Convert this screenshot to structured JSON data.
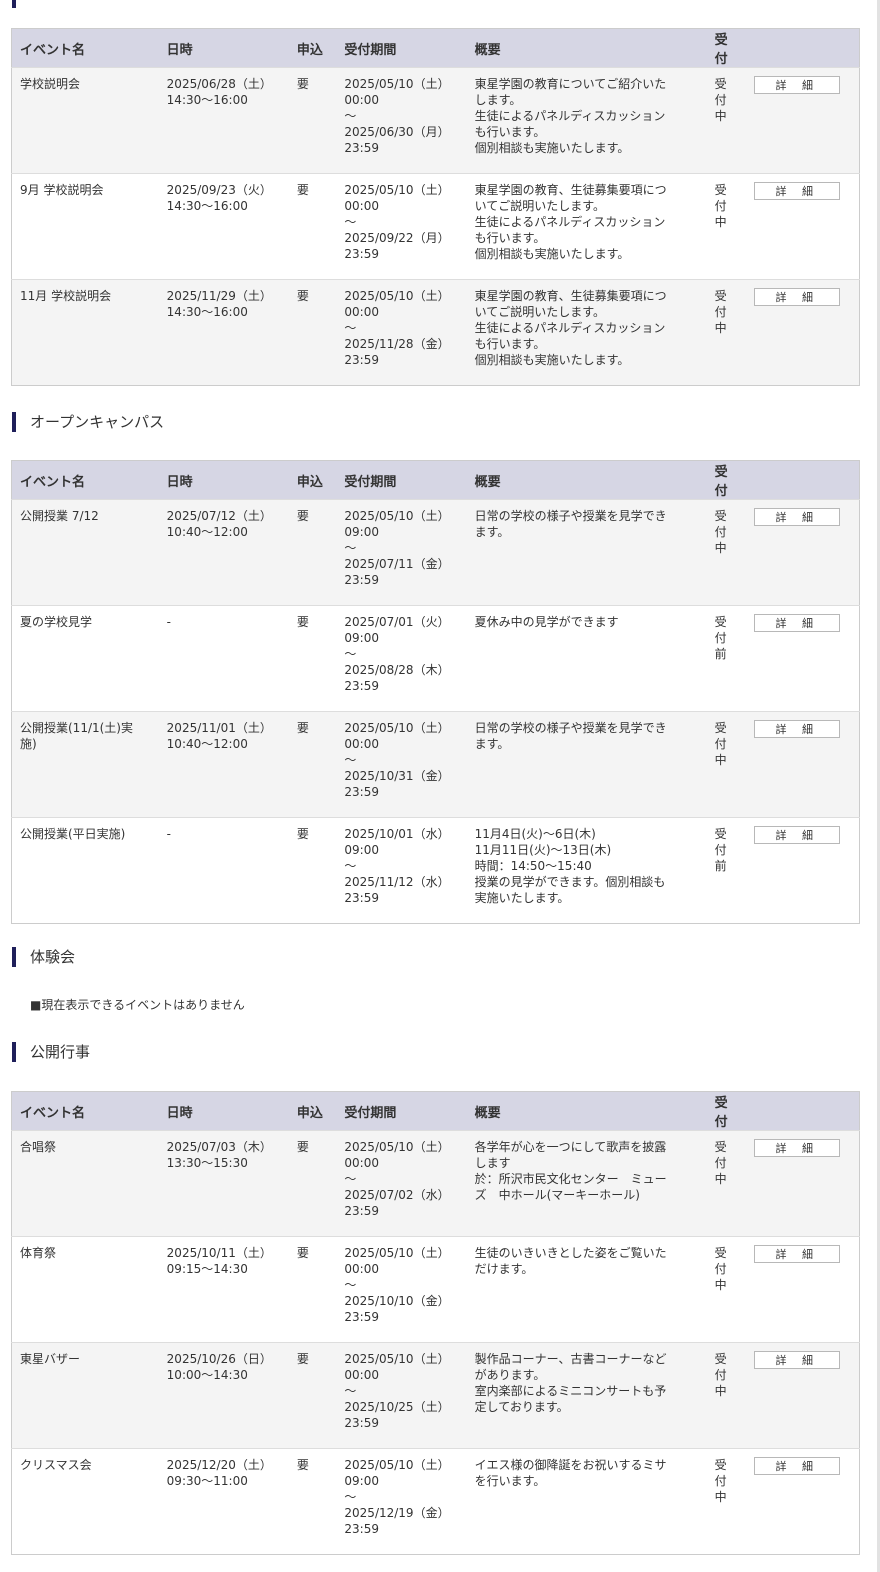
{
  "columns": {
    "name": "イベント名",
    "date": "日時",
    "apply": "申込",
    "period": "受付期間",
    "summary": "概要",
    "status": "受付"
  },
  "detail_label": "詳 細",
  "sections": [
    {
      "title": "",
      "rows": [
        {
          "name": "学校説明会",
          "date": "2025/06/28（土）\n14:30〜16:00",
          "apply": "要",
          "period": "2025/05/10（土）\n00:00\n〜\n2025/06/30（月）\n23:59",
          "summary": "東星学園の教育についてご紹介いた\nします。\n生徒によるパネルディスカッション\nも行います。\n個別相談も実施いたします。",
          "status": "受付中"
        },
        {
          "name": "9月 学校説明会",
          "date": "2025/09/23（火）\n14:30〜16:00",
          "apply": "要",
          "period": "2025/05/10（土）\n00:00\n〜\n2025/09/22（月）\n23:59",
          "summary": "東星学園の教育、生徒募集要項につ\nいてご説明いたします。\n生徒によるパネルディスカッション\nも行います。\n個別相談も実施いたします。",
          "status": "受付中"
        },
        {
          "name": "11月 学校説明会",
          "date": "2025/11/29（土）\n14:30〜16:00",
          "apply": "要",
          "period": "2025/05/10（土）\n00:00\n〜\n2025/11/28（金）\n23:59",
          "summary": "東星学園の教育、生徒募集要項につ\nいてご説明いたします。\n生徒によるパネルディスカッション\nも行います。\n個別相談も実施いたします。",
          "status": "受付中"
        }
      ]
    },
    {
      "title": "オープンキャンパス",
      "rows": [
        {
          "name": "公開授業 7/12",
          "date": "2025/07/12（土）\n10:40〜12:00",
          "apply": "要",
          "period": "2025/05/10（土）\n09:00\n〜\n2025/07/11（金）\n23:59",
          "summary": "日常の学校の様子や授業を見学でき\nます。",
          "status": "受付中"
        },
        {
          "name": "夏の学校見学",
          "date": "-",
          "apply": "要",
          "period": "2025/07/01（火）\n09:00\n〜\n2025/08/28（木）\n23:59",
          "summary": "夏休み中の見学ができます",
          "status": "受付前"
        },
        {
          "name": "公開授業(11/1(土)実\n施)",
          "date": "2025/11/01（土）\n10:40〜12:00",
          "apply": "要",
          "period": "2025/05/10（土）\n00:00\n〜\n2025/10/31（金）\n23:59",
          "summary": "日常の学校の様子や授業を見学でき\nます。",
          "status": "受付中"
        },
        {
          "name": "公開授業(平日実施)",
          "date": "-",
          "apply": "要",
          "period": "2025/10/01（水）\n09:00\n〜\n2025/11/12（水）\n23:59",
          "summary": "11月4日(火)〜6日(木)\n11月11日(火)〜13日(木)\n時間：14:50〜15:40\n授業の見学ができます。個別相談も\n実施いたします。",
          "status": "受付前"
        }
      ]
    },
    {
      "title": "体験会",
      "empty_note": "■現在表示できるイベントはありません"
    },
    {
      "title": "公開行事",
      "rows": [
        {
          "name": "合唱祭",
          "date": "2025/07/03（木）\n13:30〜15:30",
          "apply": "要",
          "period": "2025/05/10（土）\n00:00\n〜\n2025/07/02（水）\n23:59",
          "summary": "各学年が心を一つにして歌声を披露\nします\n於：所沢市民文化センター　ミュー\nズ　中ホール(マーキーホール)",
          "status": "受付中"
        },
        {
          "name": "体育祭",
          "date": "2025/10/11（土）\n09:15〜14:30",
          "apply": "要",
          "period": "2025/05/10（土）\n00:00\n〜\n2025/10/10（金）\n23:59",
          "summary": "生徒のいきいきとした姿をご覧いた\nだけます。",
          "status": "受付中"
        },
        {
          "name": "東星バザー",
          "date": "2025/10/26（日）\n10:00〜14:30",
          "apply": "要",
          "period": "2025/05/10（土）\n00:00\n〜\n2025/10/25（土）\n23:59",
          "summary": "製作品コーナー、古書コーナーなど\nがあります。\n室内楽部によるミニコンサートも予\n定しております。",
          "status": "受付中"
        },
        {
          "name": "クリスマス会",
          "date": "2025/12/20（土）\n09:30〜11:00",
          "apply": "要",
          "period": "2025/05/10（土）\n09:00\n〜\n2025/12/19（金）\n23:59",
          "summary": "イエス様の御降誕をお祝いするミサ\nを行います。",
          "status": "受付中"
        }
      ]
    }
  ]
}
